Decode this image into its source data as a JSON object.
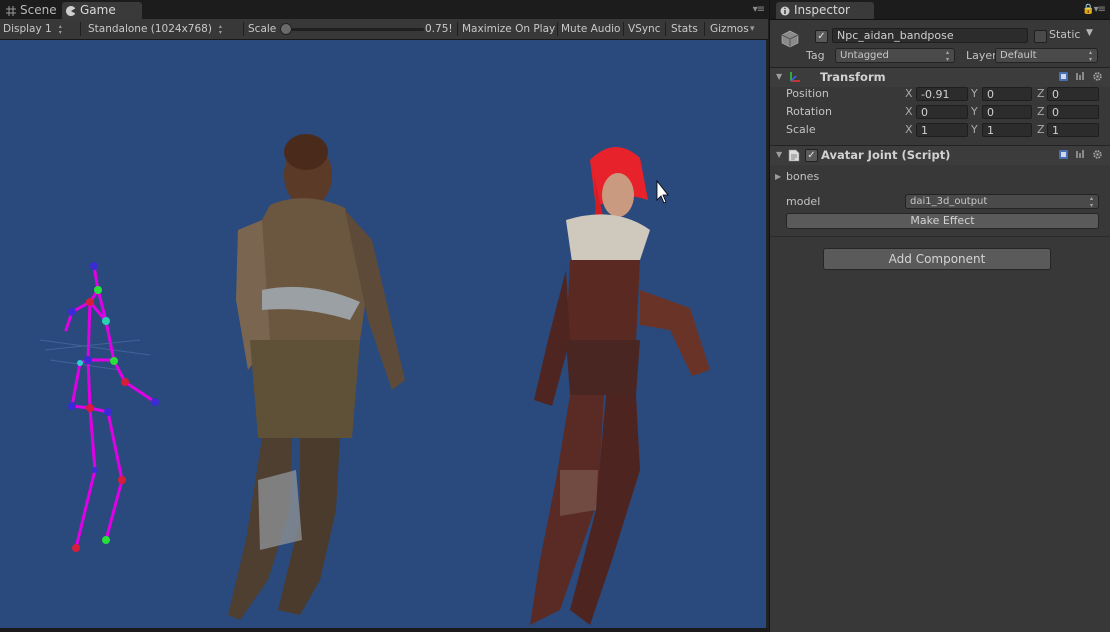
{
  "game_panel": {
    "tabs": [
      {
        "label": "Scene",
        "icon": "scene-grid-icon"
      },
      {
        "label": "Game",
        "icon": "game-pacman-icon"
      }
    ],
    "toolbar": {
      "display": "Display 1",
      "resolution": "Standalone (1024x768)",
      "scale_label": "Scale",
      "scale_value": "0.75!",
      "maximize": "Maximize On Play",
      "mute": "Mute Audio",
      "vsync": "VSync",
      "stats": "Stats",
      "gizmos": "Gizmos"
    },
    "viewport_color": "#2a4a7d",
    "skeleton_color": "#e000e6"
  },
  "inspector": {
    "tab_label": "Inspector",
    "object": {
      "name": "Npc_aidan_bandpose",
      "active": true,
      "static_label": "Static",
      "tag_label": "Tag",
      "tag_value": "Untagged",
      "layer_label": "Layer",
      "layer_value": "Default"
    },
    "transform": {
      "title": "Transform",
      "position": {
        "label": "Position",
        "x": "-0.91",
        "y": "0",
        "z": "0"
      },
      "rotation": {
        "label": "Rotation",
        "x": "0",
        "y": "0",
        "z": "0"
      },
      "scale": {
        "label": "Scale",
        "x": "1",
        "y": "1",
        "z": "1"
      },
      "axis_x": "X",
      "axis_y": "Y",
      "axis_z": "Z"
    },
    "avatar_joint": {
      "title": "Avatar Joint (Script)",
      "enabled": true,
      "bones_label": "bones",
      "model_label": "model",
      "model_value": "dai1_3d_output",
      "make_effect": "Make Effect"
    },
    "add_component": "Add Component"
  }
}
